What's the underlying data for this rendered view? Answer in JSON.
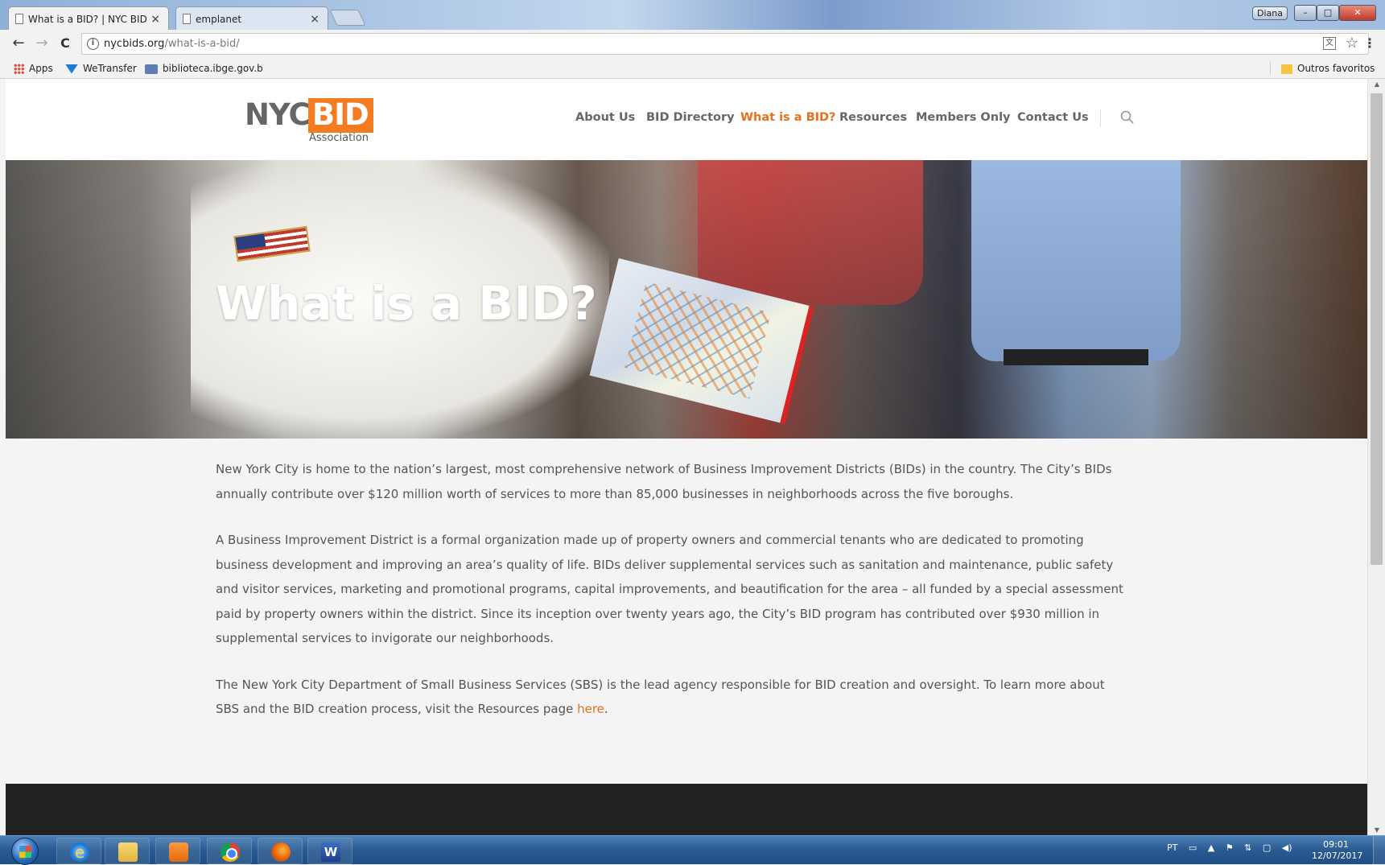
{
  "browser": {
    "tabs": [
      {
        "title": "What is a BID? | NYC BID",
        "close": "×"
      },
      {
        "title": "emplanet",
        "close": "×"
      }
    ],
    "user_badge": "Diana",
    "window_controls": {
      "minimize": "–",
      "maximize": "□",
      "close": "✕"
    },
    "nav": {
      "back": "←",
      "forward": "→",
      "reload": "C"
    },
    "url_host": "nycbids.org",
    "url_path": "/what-is-a-bid/",
    "bookmarks": [
      {
        "label": "Apps",
        "icon": "apps-grid-icon"
      },
      {
        "label": "WeTransfer",
        "icon": "wetransfer-icon"
      },
      {
        "label": "biblioteca.ibge.gov.b",
        "icon": "ibge-icon"
      }
    ],
    "other_bookmarks": "Outros favoritos"
  },
  "site": {
    "logo": {
      "nyc": "NYC",
      "bid": "BID",
      "sub": "Association"
    },
    "nav": [
      {
        "label": "About Us",
        "current": false
      },
      {
        "label": "BID Directory",
        "current": false
      },
      {
        "label": "What is a BID?",
        "current": true
      },
      {
        "label": "Resources",
        "current": false
      },
      {
        "label": "Members Only",
        "current": false
      },
      {
        "label": "Contact Us",
        "current": false
      }
    ],
    "hero_title": "What is a BID?",
    "paragraphs": [
      "New York City is home to the nation’s largest, most comprehensive network of Business Improvement Districts (BIDs) in the country. The City’s BIDs annually contribute over $120 million worth of services to more than 85,000 businesses in neighborhoods across the five boroughs.",
      "A Business Improvement District is a formal organization made up of property owners and commercial tenants who are dedicated to promoting business development and improving an area’s quality of life. BIDs deliver supplemental services such as sanitation and maintenance, public safety and visitor services, marketing and promotional programs, capital improvements, and beautification for the area – all funded by a special assessment paid by property owners within the district. Since its inception over twenty years ago, the City’s BID program has contributed over $930 million in supplemental services to invigorate our neighborhoods."
    ],
    "last_paragraph_text": "The New York City Department of Small Business Services (SBS) is the lead agency responsible for BID creation and oversight. To learn more about SBS and the BID creation process, visit the Resources page ",
    "last_paragraph_link": "here",
    "last_paragraph_end": ".",
    "accent_color": "#e8701a"
  },
  "taskbar": {
    "apps": [
      "internet-explorer-icon",
      "file-explorer-icon",
      "media-player-icon",
      "chrome-icon",
      "firefox-icon",
      "word-icon"
    ],
    "word_letter": "W",
    "language": "PT",
    "time": "09:01",
    "date": "12/07/2017"
  }
}
